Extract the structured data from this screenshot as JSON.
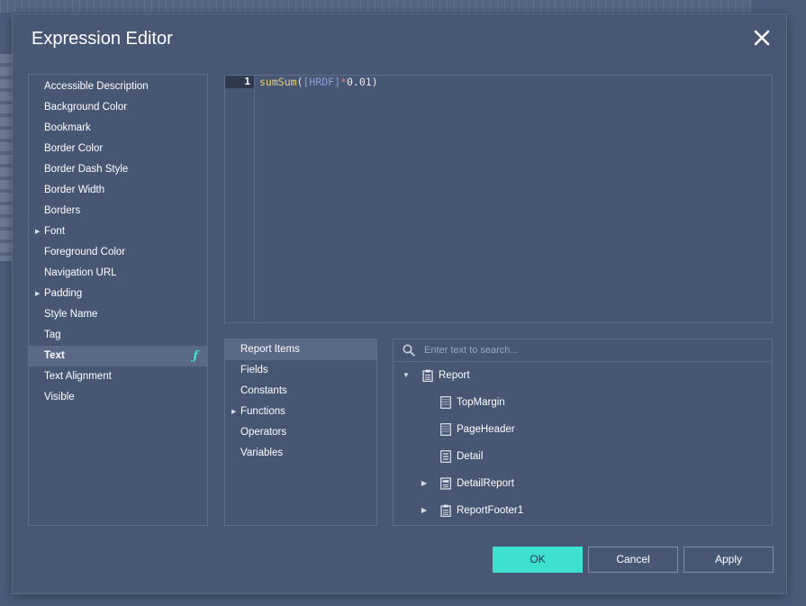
{
  "dialog": {
    "title": "Expression Editor"
  },
  "properties": {
    "items": [
      {
        "label": "Accessible Description",
        "expandable": false,
        "selected": false
      },
      {
        "label": "Background Color",
        "expandable": false,
        "selected": false
      },
      {
        "label": "Bookmark",
        "expandable": false,
        "selected": false
      },
      {
        "label": "Border Color",
        "expandable": false,
        "selected": false
      },
      {
        "label": "Border Dash Style",
        "expandable": false,
        "selected": false
      },
      {
        "label": "Border Width",
        "expandable": false,
        "selected": false
      },
      {
        "label": "Borders",
        "expandable": false,
        "selected": false
      },
      {
        "label": "Font",
        "expandable": true,
        "selected": false
      },
      {
        "label": "Foreground Color",
        "expandable": false,
        "selected": false
      },
      {
        "label": "Navigation URL",
        "expandable": false,
        "selected": false
      },
      {
        "label": "Padding",
        "expandable": true,
        "selected": false
      },
      {
        "label": "Style Name",
        "expandable": false,
        "selected": false
      },
      {
        "label": "Tag",
        "expandable": false,
        "selected": false
      },
      {
        "label": "Text",
        "expandable": false,
        "selected": true,
        "has_expression": true
      },
      {
        "label": "Text Alignment",
        "expandable": false,
        "selected": false
      },
      {
        "label": "Visible",
        "expandable": false,
        "selected": false
      }
    ],
    "expression_icon": "function-icon",
    "expression_glyph": "ƒ"
  },
  "editor": {
    "line_number": "1",
    "tokens": [
      {
        "text": "sumSum",
        "kind": "fn"
      },
      {
        "text": "(",
        "kind": "punc"
      },
      {
        "text": "[HRDF]",
        "kind": "field"
      },
      {
        "text": "*",
        "kind": "op"
      },
      {
        "text": "0.01",
        "kind": "num"
      },
      {
        "text": ")",
        "kind": "punc"
      }
    ]
  },
  "categories": {
    "items": [
      {
        "label": "Report Items",
        "expandable": false,
        "selected": true
      },
      {
        "label": "Fields",
        "expandable": false,
        "selected": false
      },
      {
        "label": "Constants",
        "expandable": false,
        "selected": false
      },
      {
        "label": "Functions",
        "expandable": true,
        "selected": false
      },
      {
        "label": "Operators",
        "expandable": false,
        "selected": false
      },
      {
        "label": "Variables",
        "expandable": false,
        "selected": false
      }
    ]
  },
  "tree": {
    "search_placeholder": "Enter text to search...",
    "nodes": [
      {
        "label": "Report",
        "level": 0,
        "toggle": "expanded",
        "icon": "report-icon"
      },
      {
        "label": "TopMargin",
        "level": 1,
        "toggle": "none",
        "icon": "band-icon"
      },
      {
        "label": "PageHeader",
        "level": 1,
        "toggle": "none",
        "icon": "band-icon"
      },
      {
        "label": "Detail",
        "level": 1,
        "toggle": "none",
        "icon": "detail-band-icon"
      },
      {
        "label": "DetailReport",
        "level": 1,
        "toggle": "collapsed",
        "icon": "detail-report-icon"
      },
      {
        "label": "ReportFooter1",
        "level": 1,
        "toggle": "collapsed",
        "icon": "report-icon"
      }
    ]
  },
  "buttons": {
    "ok": "OK",
    "cancel": "Cancel",
    "apply": "Apply"
  },
  "colors": {
    "accent": "#40e0d0",
    "background": "#475774",
    "selection": "#5a6985"
  }
}
